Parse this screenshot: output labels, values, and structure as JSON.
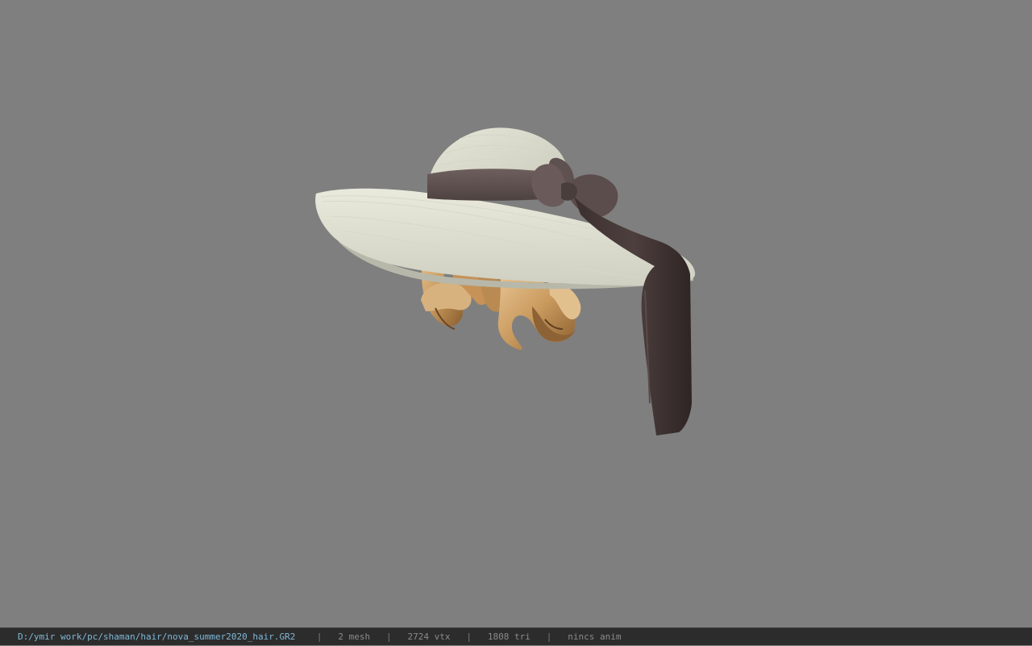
{
  "viewport": {
    "background_color": "#7f7f7f",
    "model": "hat-with-hair-icon"
  },
  "status_bar": {
    "file_path": "D:/ymir work/pc/shaman/hair/nova_summer2020_hair.GR2",
    "separator": "|",
    "mesh_count": "2 mesh",
    "vertex_count": "2724 vtx",
    "triangle_count": "1808 tri",
    "anim_status": "nincs anim",
    "path_color": "#7fb8d8",
    "background_color": "#2c2c2c"
  }
}
